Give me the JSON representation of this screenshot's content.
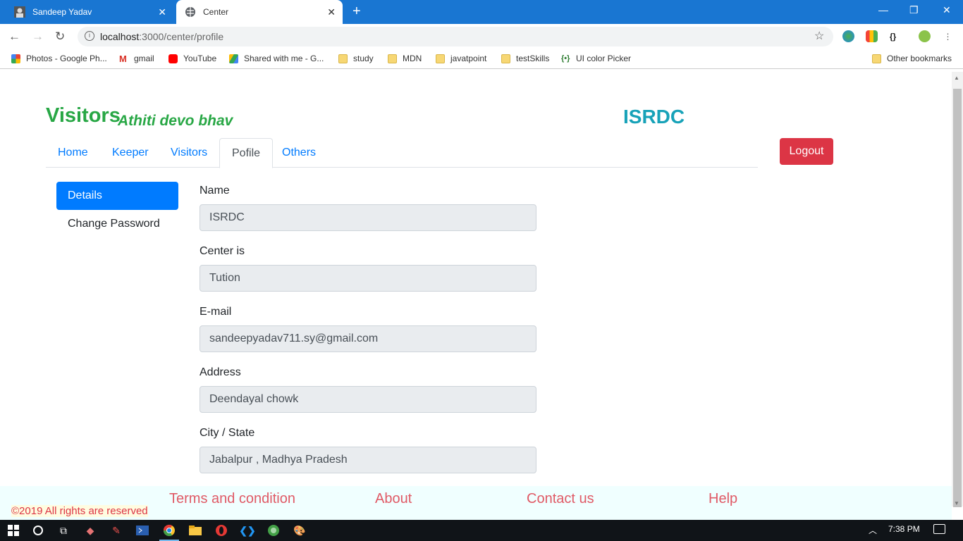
{
  "browser": {
    "tabs": [
      {
        "title": "Sandeep Yadav",
        "active": false
      },
      {
        "title": "Center",
        "active": true
      }
    ],
    "url_host": "localhost",
    "url_path": ":3000/center/profile",
    "bookmarks": [
      {
        "label": "Photos - Google Ph...",
        "icon": "photos-icon"
      },
      {
        "label": "gmail",
        "icon": "gmail-icon"
      },
      {
        "label": "YouTube",
        "icon": "youtube-icon"
      },
      {
        "label": "Shared with me - G...",
        "icon": "drive-icon"
      },
      {
        "label": "study",
        "icon": "folder-icon"
      },
      {
        "label": "MDN",
        "icon": "folder-icon"
      },
      {
        "label": "javatpoint",
        "icon": "folder-icon"
      },
      {
        "label": "testSkills",
        "icon": "folder-icon"
      },
      {
        "label": "UI color Picker",
        "icon": "color-picker-icon"
      }
    ],
    "other_bookmarks": "Other bookmarks"
  },
  "header": {
    "brand": "Visitors",
    "tagline": "Athiti devo bhav",
    "center_name": "ISRDC",
    "logout_label": "Logout"
  },
  "nav": {
    "tabs": [
      {
        "label": "Home"
      },
      {
        "label": "Keeper"
      },
      {
        "label": "Visitors"
      },
      {
        "label": "Pofile",
        "active": true
      },
      {
        "label": "Others"
      }
    ]
  },
  "sidebar": {
    "items": [
      {
        "label": "Details",
        "active": true
      },
      {
        "label": "Change Password"
      }
    ]
  },
  "profile": {
    "fields": [
      {
        "label": "Name",
        "value": "ISRDC"
      },
      {
        "label": "Center is",
        "value": "Tution"
      },
      {
        "label": "E-mail",
        "value": "sandeepyadav711.sy@gmail.com"
      },
      {
        "label": "Address",
        "value": "Deendayal chowk"
      },
      {
        "label": "City / State",
        "value": "Jabalpur , Madhya Pradesh"
      }
    ]
  },
  "footer": {
    "copyright": "©2019 All rights are reserved",
    "links": [
      "Terms and condition",
      "About",
      "Contact us",
      "Help"
    ]
  },
  "taskbar": {
    "time": "7:38 PM"
  },
  "colors": {
    "brand": "#28a745",
    "center": "#17a2b8",
    "primary": "#007bff",
    "danger": "#dc3545",
    "chrome": "#1976d2"
  }
}
